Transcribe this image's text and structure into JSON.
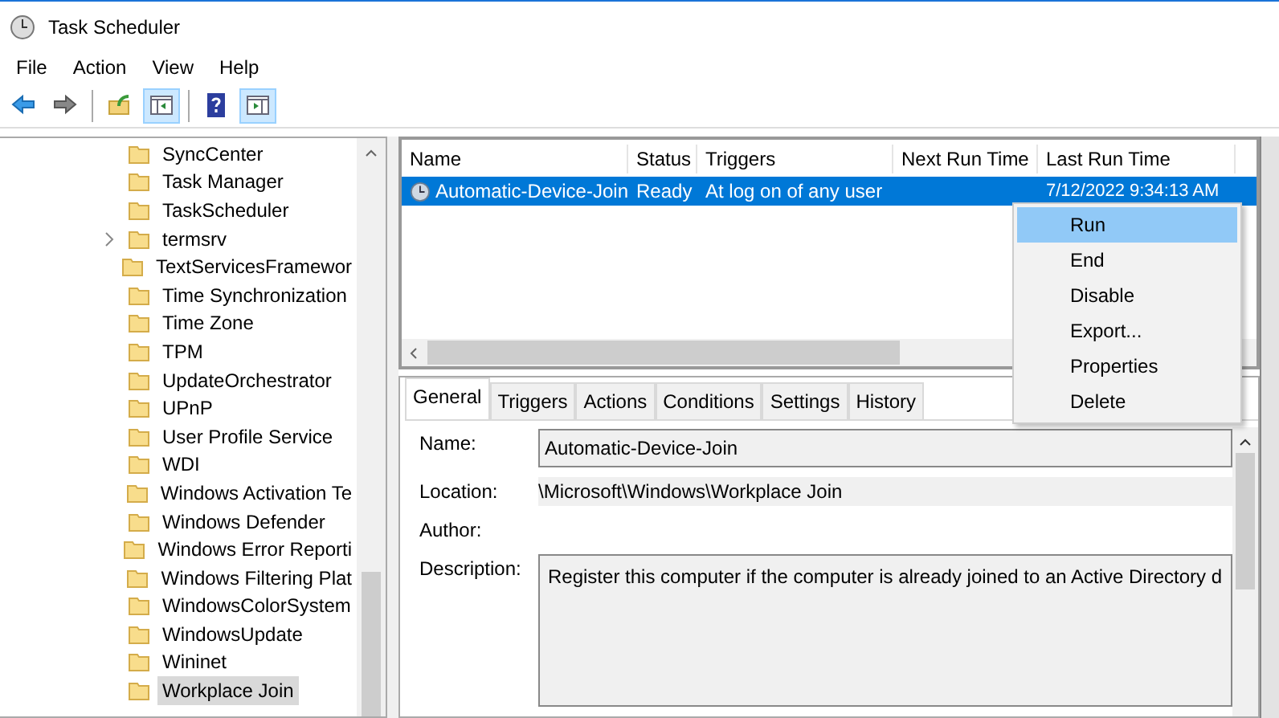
{
  "window": {
    "title": "Task Scheduler"
  },
  "menu": [
    "File",
    "Action",
    "View",
    "Help"
  ],
  "toolbar": [
    {
      "kind": "back",
      "pressed": false
    },
    {
      "kind": "forward",
      "pressed": false
    },
    {
      "kind": "separator"
    },
    {
      "kind": "up",
      "pressed": false
    },
    {
      "kind": "tree-pane",
      "pressed": true
    },
    {
      "kind": "separator"
    },
    {
      "kind": "help",
      "pressed": false
    },
    {
      "kind": "action-pane",
      "pressed": true
    }
  ],
  "tree": {
    "items": [
      {
        "label": "SyncCenter",
        "selected": false,
        "expandable": false
      },
      {
        "label": "Task Manager",
        "selected": false,
        "expandable": false
      },
      {
        "label": "TaskScheduler",
        "selected": false,
        "expandable": false
      },
      {
        "label": "termsrv",
        "selected": false,
        "expandable": true
      },
      {
        "label": "TextServicesFramewor",
        "selected": false,
        "expandable": false
      },
      {
        "label": "Time Synchronization",
        "selected": false,
        "expandable": false
      },
      {
        "label": "Time Zone",
        "selected": false,
        "expandable": false
      },
      {
        "label": "TPM",
        "selected": false,
        "expandable": false
      },
      {
        "label": "UpdateOrchestrator",
        "selected": false,
        "expandable": false
      },
      {
        "label": "UPnP",
        "selected": false,
        "expandable": false
      },
      {
        "label": "User Profile Service",
        "selected": false,
        "expandable": false
      },
      {
        "label": "WDI",
        "selected": false,
        "expandable": false
      },
      {
        "label": "Windows Activation Te",
        "selected": false,
        "expandable": false
      },
      {
        "label": "Windows Defender",
        "selected": false,
        "expandable": false
      },
      {
        "label": "Windows Error Reporti",
        "selected": false,
        "expandable": false
      },
      {
        "label": "Windows Filtering Plat",
        "selected": false,
        "expandable": false
      },
      {
        "label": "WindowsColorSystem",
        "selected": false,
        "expandable": false
      },
      {
        "label": "WindowsUpdate",
        "selected": false,
        "expandable": false
      },
      {
        "label": "Wininet",
        "selected": false,
        "expandable": false
      },
      {
        "label": "Workplace Join",
        "selected": true,
        "expandable": false
      }
    ]
  },
  "task_list": {
    "columns": [
      "Name",
      "Status",
      "Triggers",
      "Next Run Time",
      "Last Run Time"
    ],
    "rows": [
      {
        "name": "Automatic-Device-Join",
        "status": "Ready",
        "triggers": "At log on of any user",
        "last_run_time": "7/12/2022 9:34:13 AM",
        "selected": true
      }
    ]
  },
  "context_menu": {
    "items": [
      {
        "label": "Run",
        "selected": true
      },
      {
        "label": "End",
        "selected": false
      },
      {
        "label": "Disable",
        "selected": false
      },
      {
        "label": "Export...",
        "selected": false
      },
      {
        "label": "Properties",
        "selected": false
      },
      {
        "label": "Delete",
        "selected": false
      }
    ]
  },
  "details": {
    "tabs": [
      {
        "label": "General",
        "selected": true
      },
      {
        "label": "Triggers",
        "selected": false
      },
      {
        "label": "Actions",
        "selected": false
      },
      {
        "label": "Conditions",
        "selected": false
      },
      {
        "label": "Settings",
        "selected": false
      },
      {
        "label": "History",
        "selected": false
      }
    ],
    "fields": [
      {
        "label": "Name:",
        "value": "Automatic-Device-Join",
        "kind": "textbox"
      },
      {
        "label": "Location:",
        "value": "\\Microsoft\\Windows\\Workplace Join",
        "kind": "readonly"
      },
      {
        "label": "Author:",
        "kind": "readonly"
      },
      {
        "label": "Description:",
        "value": "Register this computer if the computer is already joined to an Active Directory d",
        "kind": "textarea"
      }
    ]
  }
}
